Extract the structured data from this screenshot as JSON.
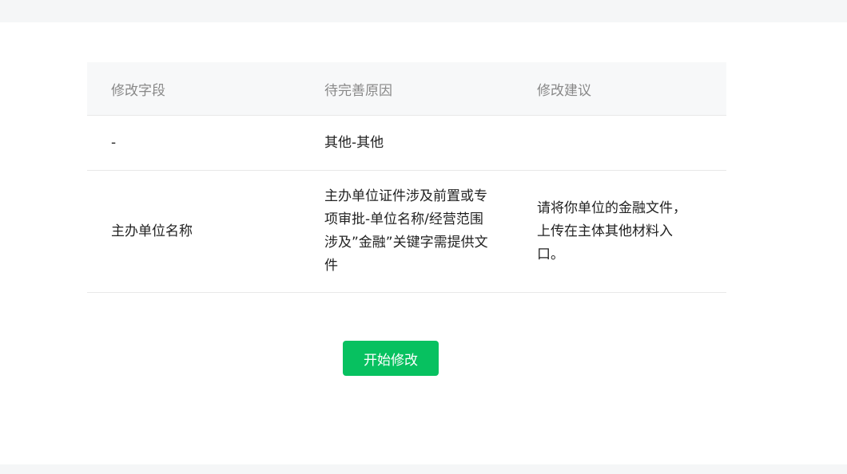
{
  "table": {
    "headers": [
      "修改字段",
      "待完善原因",
      "修改建议"
    ],
    "rows": [
      {
        "field": "-",
        "reason": "其他-其他",
        "suggestion": ""
      },
      {
        "field": "主办单位名称",
        "reason": "主办单位证件涉及前置或专项审批-单位名称/经营范围涉及”金融”关键字需提供文件",
        "suggestion": "请将你单位的金融文件，上传在主体其他材料入口。"
      }
    ]
  },
  "actions": {
    "start_edit_label": "开始修改",
    "accent_color": "#07c160"
  }
}
